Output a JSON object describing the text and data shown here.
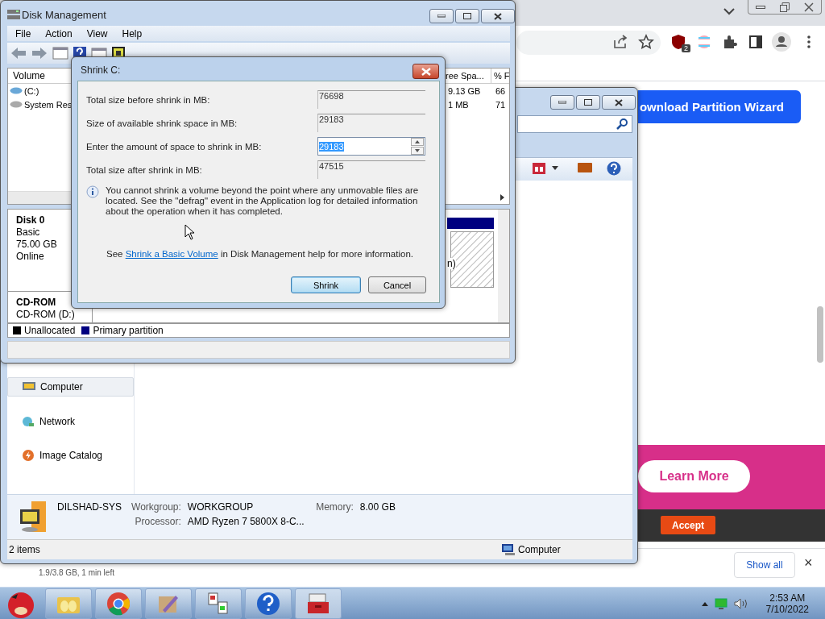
{
  "browser": {
    "extension_badge": "2",
    "download_button": "ownload Partition Wizard",
    "ad_button": "Learn More",
    "cookie_button": "Accept",
    "download_shelf": {
      "status": "1.9/3.8 GB, 1 min left",
      "show_all": "Show all",
      "close": "×"
    }
  },
  "explorer": {
    "nav": [
      {
        "label": "Computer",
        "selected": true
      },
      {
        "label": "Network",
        "selected": false
      },
      {
        "label": "Image Catalog",
        "selected": false
      }
    ],
    "details": {
      "name": "DILSHAD-SYS",
      "fields": [
        {
          "label": "Workgroup:",
          "value": "WORKGROUP"
        },
        {
          "label": "Memory:",
          "value": "8.00 GB"
        },
        {
          "label": "Processor:",
          "value": "AMD Ryzen 7 5800X 8-C..."
        }
      ]
    },
    "status": {
      "count": "2 items",
      "location": "Computer"
    }
  },
  "disk_management": {
    "title": "Disk Management",
    "menu": [
      "File",
      "Action",
      "View",
      "Help"
    ],
    "columns": [
      "Volume",
      "ree Spa...",
      "% F"
    ],
    "rows": [
      [
        "(C:)",
        "9.13 GB",
        "66"
      ],
      [
        "System Res",
        "1 MB",
        "71"
      ]
    ],
    "disks": [
      {
        "name": "Disk 0",
        "lines": [
          "Basic",
          "75.00 GB",
          "Online"
        ]
      },
      {
        "name": "CD-ROM",
        "lines": [
          "CD-ROM (D:)"
        ]
      }
    ],
    "partition_fragment": "n)",
    "legend": [
      {
        "label": "Unallocated",
        "color": "#000000"
      },
      {
        "label": "Primary partition",
        "color": "#000080"
      }
    ]
  },
  "dialog": {
    "title": "Shrink C:",
    "fields": [
      {
        "label": "Total size before shrink in MB:",
        "value": "76698",
        "editable": false
      },
      {
        "label": "Size of available shrink space in MB:",
        "value": "29183",
        "editable": false
      },
      {
        "label": "Enter the amount of space to shrink in MB:",
        "value": "29183",
        "editable": true
      },
      {
        "label": "Total size after shrink in MB:",
        "value": "47515",
        "editable": false
      }
    ],
    "info": "You cannot shrink a volume beyond the point where any unmovable files are located. See the \"defrag\" event in the Application log for detailed information about the operation when it has completed.",
    "help": {
      "before": "See",
      "link": "Shrink a Basic Volume",
      "after": "in Disk Management help for more information."
    },
    "buttons": [
      {
        "label": "Shrink",
        "default": true
      },
      {
        "label": "Cancel",
        "default": false
      }
    ]
  },
  "taskbar": {
    "time": "2:53 AM",
    "date": "7/10/2022"
  }
}
